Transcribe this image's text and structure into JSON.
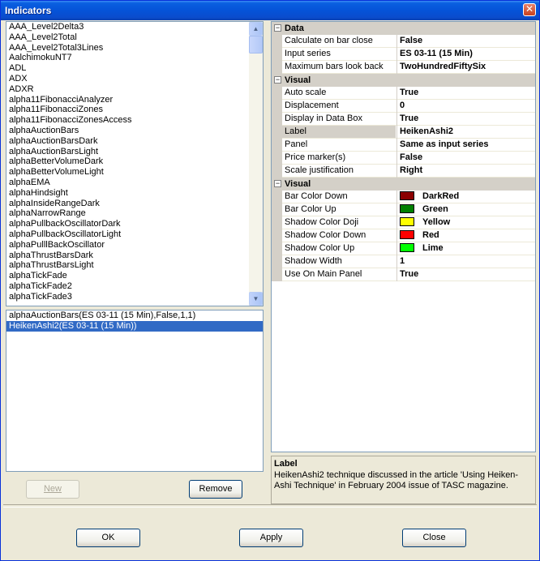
{
  "window": {
    "title": "Indicators"
  },
  "indicator_list": {
    "items": [
      "AAA_Level2Delta3",
      "AAA_Level2Total",
      "AAA_Level2Total3Lines",
      "AalchimokuNT7",
      "ADL",
      "ADX",
      "ADXR",
      "alpha11FibonacciAnalyzer",
      "alpha11FibonacciZones",
      "alpha11FibonacciZonesAccess",
      "alphaAuctionBars",
      "alphaAuctionBarsDark",
      "alphaAuctionBarsLight",
      "alphaBetterVolumeDark",
      "alphaBetterVolumeLight",
      "alphaEMA",
      "alphaHindsight",
      "alphaInsideRangeDark",
      "alphaNarrowRange",
      "alphaPullbackOscillatorDark",
      "alphaPullbackOscillatorLight",
      "alphaPulllBackOscillator",
      "alphaThrustBarsDark",
      "alphaThrustBarsLight",
      "alphaTickFade",
      "alphaTickFade2",
      "alphaTickFade3"
    ]
  },
  "applied_list": {
    "items": [
      {
        "label": "alphaAuctionBars(ES 03-11 (15 Min),False,1,1)",
        "selected": false
      },
      {
        "label": "HeikenAshi2(ES 03-11 (15 Min))",
        "selected": true
      }
    ]
  },
  "buttons": {
    "new": "New",
    "remove": "Remove",
    "ok": "OK",
    "apply": "Apply",
    "close": "Close"
  },
  "properties": {
    "sections": [
      {
        "name": "Data",
        "rows": [
          {
            "name": "Calculate on bar close",
            "value": "False"
          },
          {
            "name": "Input series",
            "value": "ES 03-11 (15 Min)"
          },
          {
            "name": "Maximum bars look back",
            "value": "TwoHundredFiftySix"
          }
        ]
      },
      {
        "name": "Visual",
        "rows": [
          {
            "name": "Auto scale",
            "value": "True"
          },
          {
            "name": "Displacement",
            "value": "0"
          },
          {
            "name": "Display in Data Box",
            "value": "True"
          },
          {
            "name": "Label",
            "value": "HeikenAshi2",
            "highlight": true
          },
          {
            "name": "Panel",
            "value": "Same as input series"
          },
          {
            "name": "Price marker(s)",
            "value": "False"
          },
          {
            "name": "Scale justification",
            "value": "Right"
          }
        ]
      },
      {
        "name": "Visual",
        "rows": [
          {
            "name": "Bar Color Down",
            "value": "DarkRed",
            "color": "#8b0000"
          },
          {
            "name": "Bar Color Up",
            "value": "Green",
            "color": "#008000"
          },
          {
            "name": "Shadow Color Doji",
            "value": "Yellow",
            "color": "#ffff00"
          },
          {
            "name": "Shadow Color Down",
            "value": "Red",
            "color": "#ff0000"
          },
          {
            "name": "Shadow Color Up",
            "value": "Lime",
            "color": "#00ff00"
          },
          {
            "name": "Shadow Width",
            "value": "1"
          },
          {
            "name": "Use On Main Panel",
            "value": "True"
          }
        ]
      }
    ]
  },
  "description": {
    "title": "Label",
    "text": "HeikenAshi2 technique discussed in the article 'Using Heiken-Ashi Technique' in February 2004 issue of TASC magazine."
  }
}
